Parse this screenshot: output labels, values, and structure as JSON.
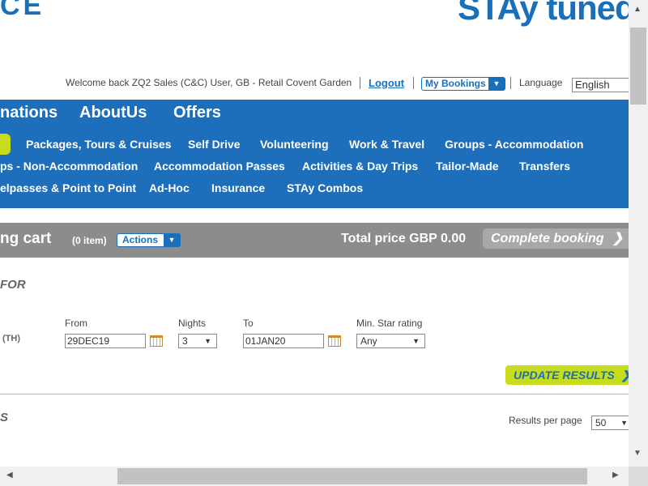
{
  "header": {
    "logo_left_text": "CE",
    "logo_right_text": "STAy tuned",
    "welcome_text": "Welcome back ZQ2 Sales (C&C) User, GB - Retail Covent Garden",
    "logout_label": "Logout",
    "my_bookings_label": "My Bookings",
    "language_label": "Language",
    "language_value": "English"
  },
  "top_nav": {
    "items": [
      "nations",
      "AboutUs",
      "Offers"
    ]
  },
  "sub_nav": {
    "row1": [
      "Packages, Tours & Cruises",
      "Self Drive",
      "Volunteering",
      "Work & Travel",
      "Groups - Accommodation"
    ],
    "row2": [
      "ps - Non-Accommodation",
      "Accommodation Passes",
      "Activities & Day Trips",
      "Tailor-Made",
      "Transfers"
    ],
    "row3": [
      "elpasses & Point to Point",
      "Ad-Hoc",
      "Insurance",
      "STAy Combos"
    ]
  },
  "cart": {
    "title": "ng cart",
    "count": "(0 item)",
    "actions_label": "Actions",
    "total_label": "Total price GBP 0.00",
    "complete_label": "Complete booking"
  },
  "search": {
    "section_title": "FOR",
    "location_code": "(TH)",
    "from_label": "From",
    "from_value": "29DEC19",
    "nights_label": "Nights",
    "nights_value": "3",
    "to_label": "To",
    "to_value": "01JAN20",
    "star_label": "Min. Star rating",
    "star_value": "Any",
    "update_label": "UPDATE RESULTS"
  },
  "results": {
    "section_title": "S",
    "per_page_label": "Results per page",
    "per_page_value": "50"
  },
  "colors": {
    "brand_blue": "#1d6fbc",
    "accent_lime": "#c8dc1e",
    "cart_gray": "#8c8c8c"
  }
}
